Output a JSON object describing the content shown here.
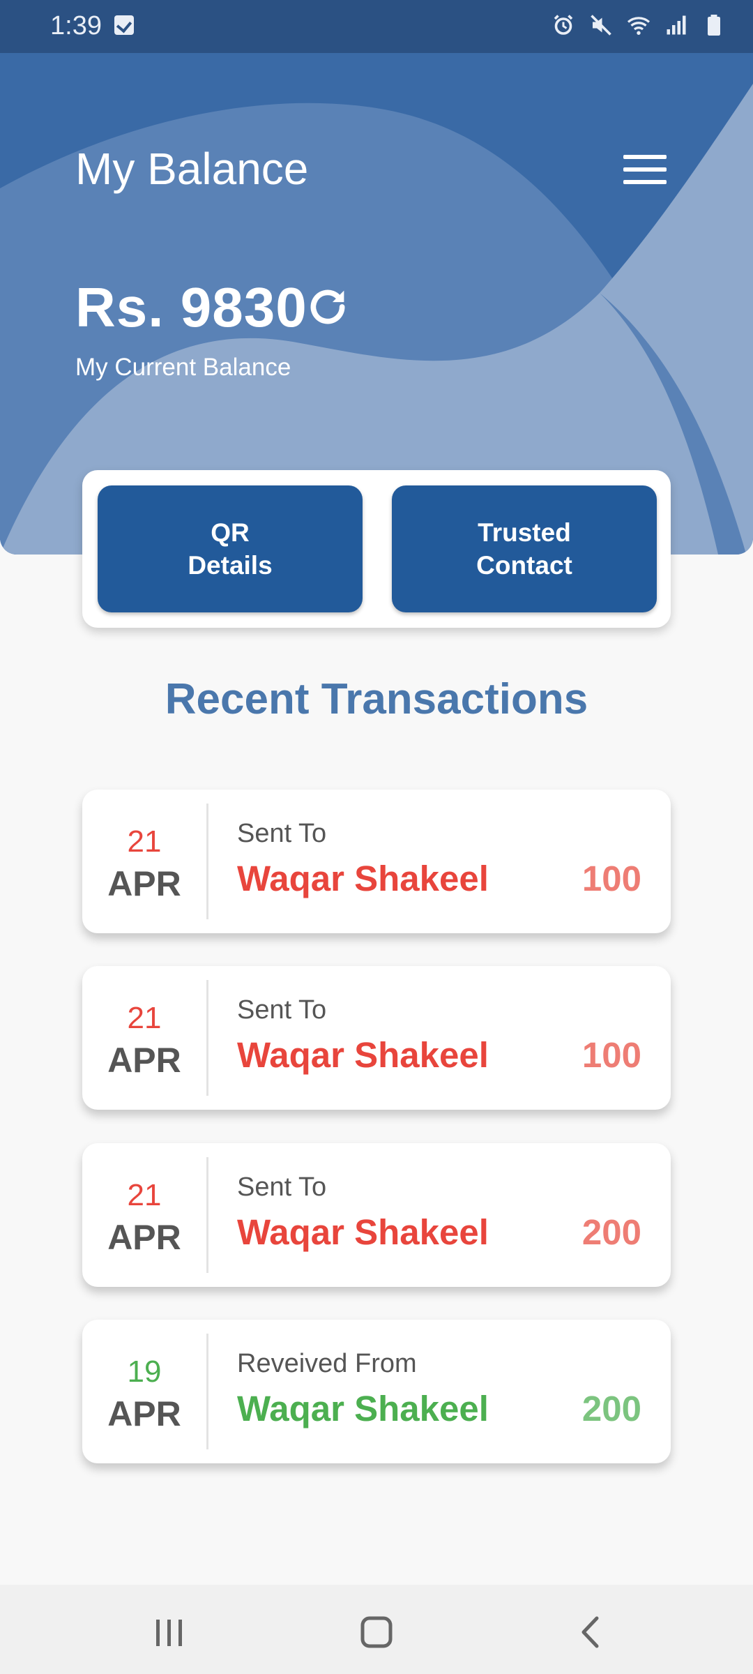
{
  "status_bar": {
    "time": "1:39",
    "icons": [
      "checkbox-notification-icon",
      "alarm-icon",
      "mute-icon",
      "wifi-icon",
      "signal-icon",
      "battery-icon"
    ]
  },
  "header": {
    "title": "My Balance",
    "balance": "Rs. 9830",
    "balance_caption": "My Current Balance",
    "menu_icon": "hamburger-menu-icon",
    "refresh_icon": "refresh-icon"
  },
  "actions": {
    "qr_label_line1": "QR",
    "qr_label_line2": "Details",
    "trusted_label_line1": "Trusted",
    "trusted_label_line2": "Contact"
  },
  "transactions": {
    "title": "Recent Transactions",
    "items": [
      {
        "day": "21",
        "month": "APR",
        "type": "Sent To",
        "name": "Waqar Shakeel",
        "amount": "100",
        "kind": "sent"
      },
      {
        "day": "21",
        "month": "APR",
        "type": "Sent To",
        "name": "Waqar Shakeel",
        "amount": "100",
        "kind": "sent"
      },
      {
        "day": "21",
        "month": "APR",
        "type": "Sent To",
        "name": "Waqar Shakeel",
        "amount": "200",
        "kind": "sent"
      },
      {
        "day": "19",
        "month": "APR",
        "type": "Reveived From",
        "name": "Waqar Shakeel",
        "amount": "200",
        "kind": "received"
      }
    ]
  },
  "colors": {
    "header_blue": "#3a6aa6",
    "button_blue": "#225a9a",
    "title_blue": "#4a77ac",
    "sent_red": "#e8453c",
    "sent_amount": "#ee7d74",
    "received_green": "#4caf50",
    "received_amount": "#7cc47f"
  },
  "navbar": {
    "icons": [
      "recent-apps-icon",
      "home-icon",
      "back-icon"
    ]
  }
}
